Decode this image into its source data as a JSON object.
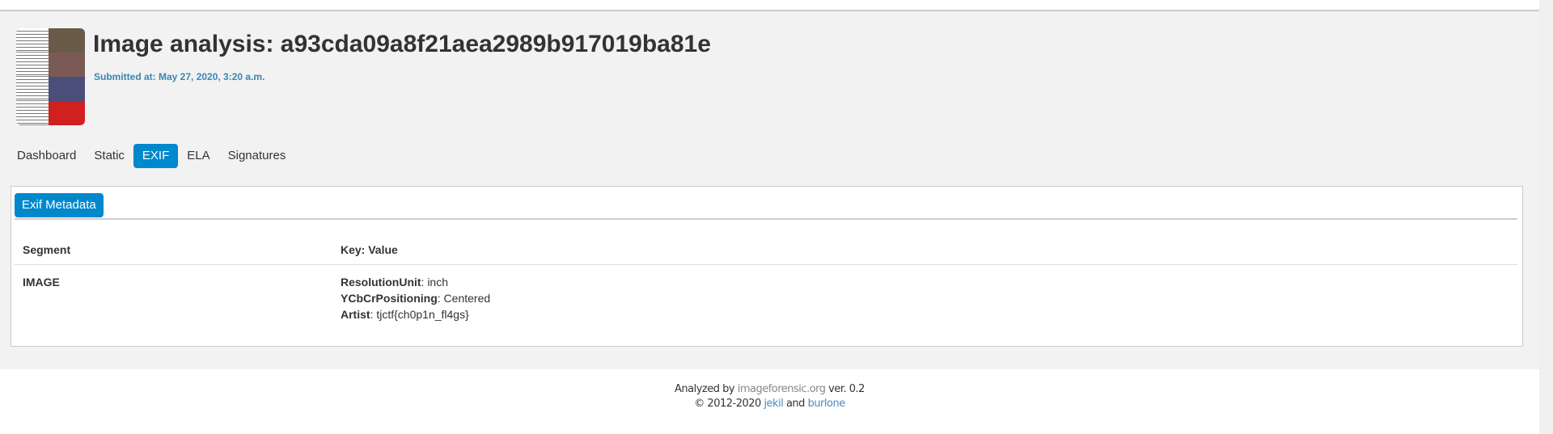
{
  "header": {
    "title": "Image analysis: a93cda09a8f21aea2989b917019ba81e",
    "submitted": "Submitted at: May 27, 2020, 3:20 a.m."
  },
  "tabs": [
    {
      "label": "Dashboard"
    },
    {
      "label": "Static"
    },
    {
      "label": "EXIF",
      "active": true
    },
    {
      "label": "ELA"
    },
    {
      "label": "Signatures"
    }
  ],
  "panel": {
    "button": "Exif Metadata",
    "columns": [
      "Segment",
      "Key: Value"
    ],
    "rows": [
      {
        "segment": "IMAGE",
        "entries": [
          {
            "key": "ResolutionUnit",
            "value": ": inch"
          },
          {
            "key": "YCbCrPositioning",
            "value": ": Centered"
          },
          {
            "key": "Artist",
            "value": ": tjctf{ch0p1n_fl4gs}"
          }
        ]
      }
    ]
  },
  "footer": {
    "analyzed_by": "Analyzed by",
    "site": "imageforensic.org",
    "version": "ver. 0.2",
    "copyright": "© 2012-2020",
    "author1": "jekil",
    "and": "and",
    "author2": "burlone"
  },
  "colors": {
    "accent": "#0088cc",
    "submitted": "#3a87b5"
  }
}
